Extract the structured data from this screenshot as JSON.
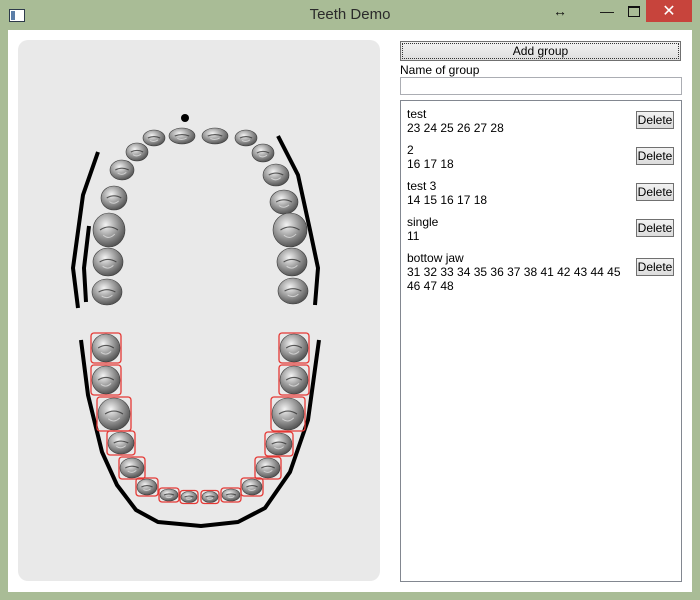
{
  "window": {
    "title": "Teeth Demo",
    "app_icon": "app-window-icon",
    "controls": [
      "resize-icon",
      "minimize-icon",
      "maximize-icon",
      "close-icon"
    ]
  },
  "controls": {
    "add_group_label": "Add group",
    "name_label": "Name of group",
    "name_value": "",
    "delete_label": "Delete"
  },
  "groups": [
    {
      "name": "test",
      "teeth": "23 24 25 26 27 28"
    },
    {
      "name": "2",
      "teeth": "16 17 18"
    },
    {
      "name": "test 3",
      "teeth": "14 15 16 17 18"
    },
    {
      "name": "single",
      "teeth": "11"
    },
    {
      "name": "bottow jaw",
      "teeth": "31 32 33 34 35 36 37 38 41 42 43 44 45 46 47 48"
    }
  ],
  "colors": {
    "window_frame": "#a9bc96",
    "close_button": "#c7443c",
    "teeth_panel": "#e9e9e9",
    "selected_outline": "#e53935"
  },
  "teeth_chart": {
    "upper_jaw_selected": false,
    "lower_jaw_selected": true
  }
}
